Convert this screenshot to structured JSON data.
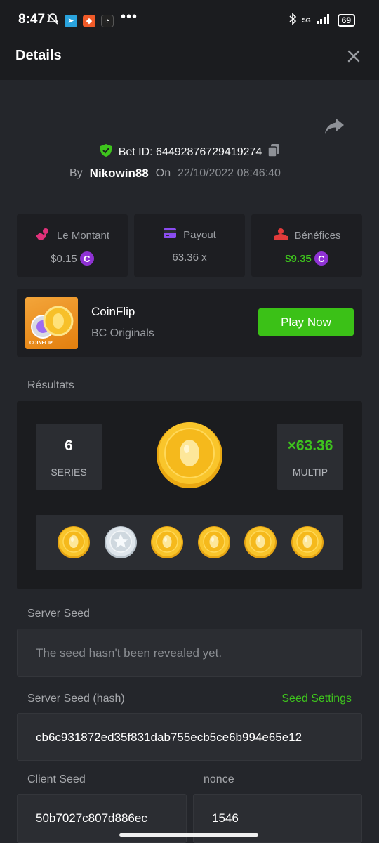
{
  "status_bar": {
    "time": "8:47",
    "network": "5G",
    "battery": "69"
  },
  "header": {
    "title": "Details"
  },
  "bet": {
    "id_label": "Bet ID: 64492876729419274",
    "by_label": "By",
    "username": "Nikowin88",
    "on_label": "On",
    "datetime": "22/10/2022 08:46:40"
  },
  "stats": {
    "amount_label": "Le Montant",
    "amount_value": "$0.15",
    "payout_label": "Payout",
    "payout_value": "63.36 x",
    "profit_label": "Bénéfices",
    "profit_value": "$9.35",
    "coin_symbol": "C"
  },
  "game": {
    "thumb_label": "COINFLIP",
    "name": "CoinFlip",
    "provider": "BC Originals",
    "play_label": "Play Now"
  },
  "results": {
    "label": "Résultats",
    "series_value": "6",
    "series_label": "SERIES",
    "multiplier_value": "×63.36",
    "multiplier_label": "MULTIP",
    "flips": [
      "gold",
      "silver",
      "gold",
      "gold",
      "gold",
      "gold"
    ]
  },
  "server_seed": {
    "label": "Server Seed",
    "value": "The seed hasn't been revealed yet."
  },
  "server_seed_hash": {
    "label": "Server Seed (hash)",
    "settings_label": "Seed Settings",
    "value": "cb6c931872ed35f831dab755ecb5ce6b994e65e12"
  },
  "client_seed": {
    "label": "Client Seed",
    "value": "50b7027c807d886ec"
  },
  "nonce": {
    "label": "nonce",
    "value": "1546"
  },
  "colors": {
    "accent_green": "#3ec41d",
    "coin_purple": "#8f32d4",
    "background": "#24262b",
    "card": "#1d1e22"
  }
}
